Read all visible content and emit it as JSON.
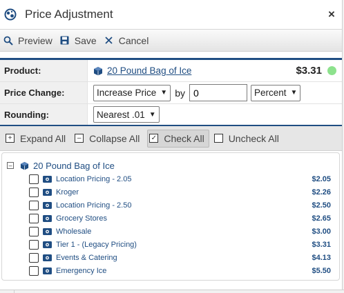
{
  "dialog": {
    "title": "Price Adjustment",
    "close_label": "×"
  },
  "toolbar": {
    "preview_label": "Preview",
    "save_label": "Save",
    "cancel_label": "Cancel"
  },
  "form": {
    "product_label": "Product:",
    "product_name": "20 Pound Bag of Ice",
    "product_price": "$3.31",
    "price_change_label": "Price Change:",
    "price_change_direction": "Increase Price",
    "by_label": "by",
    "amount_value": "0",
    "amount_unit": "Percent",
    "rounding_label": "Rounding:",
    "rounding_value": "Nearest .01"
  },
  "tree_toolbar": {
    "expand_all": "Expand All",
    "collapse_all": "Collapse All",
    "check_all": "Check All",
    "uncheck_all": "Uncheck All"
  },
  "tree": {
    "root_label": "20 Pound Bag of Ice",
    "items": [
      {
        "label": "Location Pricing - 2.05",
        "price": "$2.05"
      },
      {
        "label": "Kroger",
        "price": "$2.26"
      },
      {
        "label": "Location Pricing - 2.50",
        "price": "$2.50"
      },
      {
        "label": "Grocery Stores",
        "price": "$2.65"
      },
      {
        "label": "Wholesale",
        "price": "$3.00"
      },
      {
        "label": "Tier 1 - (Legacy Pricing)",
        "price": "$3.31"
      },
      {
        "label": "Events & Catering",
        "price": "$4.13"
      },
      {
        "label": "Emergency Ice",
        "price": "$5.50"
      }
    ]
  },
  "colors": {
    "accent": "#1f4d82",
    "status_dot": "#8de28d"
  },
  "icons": {
    "app": "globe-icon",
    "preview": "search-icon",
    "save": "floppy-icon",
    "cancel": "close-icon",
    "product": "cube-icon",
    "price_level": "money-icon"
  }
}
